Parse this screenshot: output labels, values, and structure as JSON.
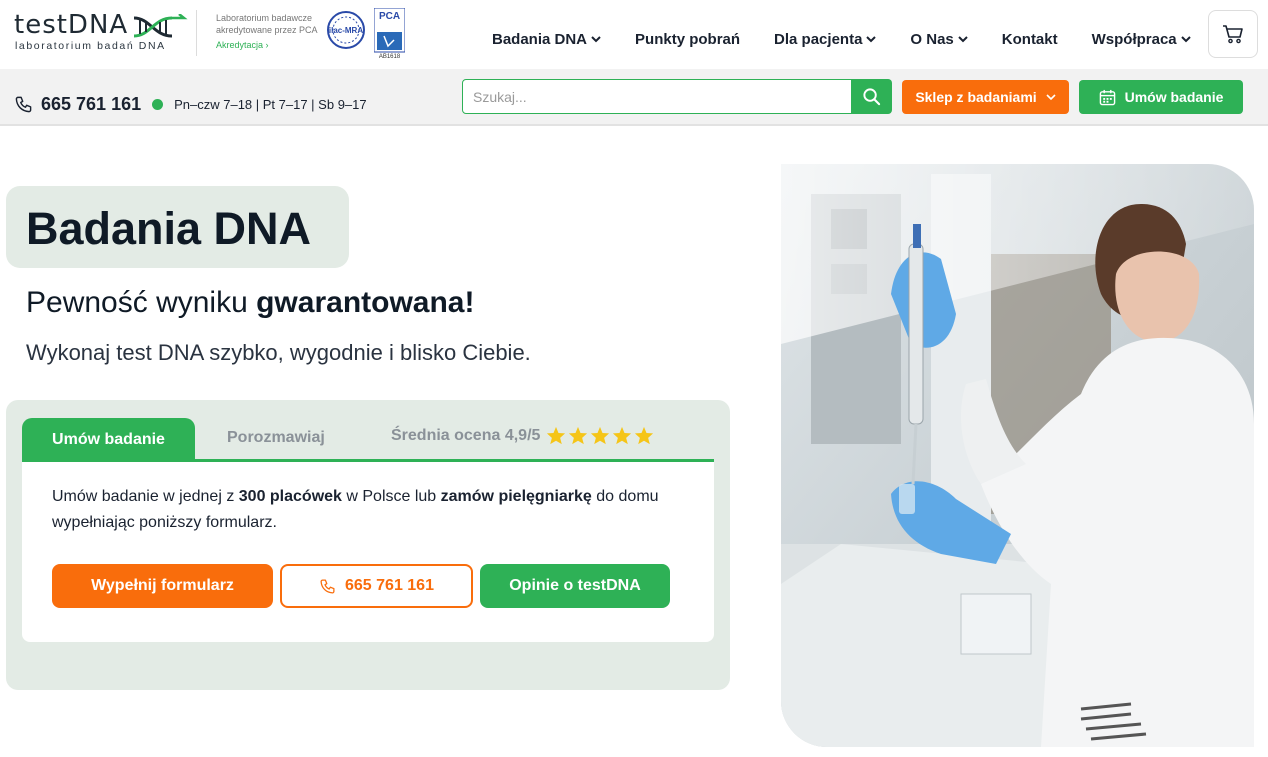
{
  "header": {
    "logo_word": "testDNA",
    "logo_sub": "laboratorium badań DNA",
    "accreditation_line1": "Laboratorium badawcze",
    "accreditation_line2": "akredytowane przez PCA",
    "accreditation_link": "Akredytacja ›",
    "ilac_badge": "ilac-MRA",
    "pca_badge": "PCA",
    "pca_code": "AB1618",
    "nav": [
      {
        "label": "Badania DNA",
        "dropdown": true
      },
      {
        "label": "Punkty pobrań",
        "dropdown": false
      },
      {
        "label": "Dla pacjenta",
        "dropdown": true
      },
      {
        "label": "O Nas",
        "dropdown": true
      },
      {
        "label": "Kontakt",
        "dropdown": false
      },
      {
        "label": "Współpraca",
        "dropdown": true
      }
    ],
    "cart_icon": "cart-icon"
  },
  "subbar": {
    "phone": "665 761 161",
    "hours": "Pn–czw 7–18 | Pt 7–17 | Sb 9–17",
    "search_placeholder": "Szukaj...",
    "shop_label": "Sklep z badaniami",
    "book_label": "Umów badanie"
  },
  "hero": {
    "title": "Badania DNA",
    "tagline_regular": "Pewność wyniku ",
    "tagline_bold": "gwarantowana!",
    "subtitle": "Wykonaj test DNA szybko, wygodnie i blisko Ciebie."
  },
  "panel": {
    "tabs": [
      "Umów badanie",
      "Porozmawiaj"
    ],
    "rating_text": "Średnia ocena 4,9/5",
    "rating_stars": 5,
    "text_part1": "Umów badanie w jednej z ",
    "text_bold1": "300 placówek",
    "text_part2": " w Polsce lub ",
    "text_bold2": "zamów pielęgniarkę",
    "text_part3": " do domu wypełniając poniższy formularz.",
    "btn_form": "Wypełnij formularz",
    "btn_call": "665 761 161",
    "btn_reviews": "Opinie o testDNA"
  },
  "colors": {
    "green": "#2eb156",
    "orange": "#f96d0c",
    "panel_bg": "#e3ebe5",
    "star": "#f5c518"
  }
}
